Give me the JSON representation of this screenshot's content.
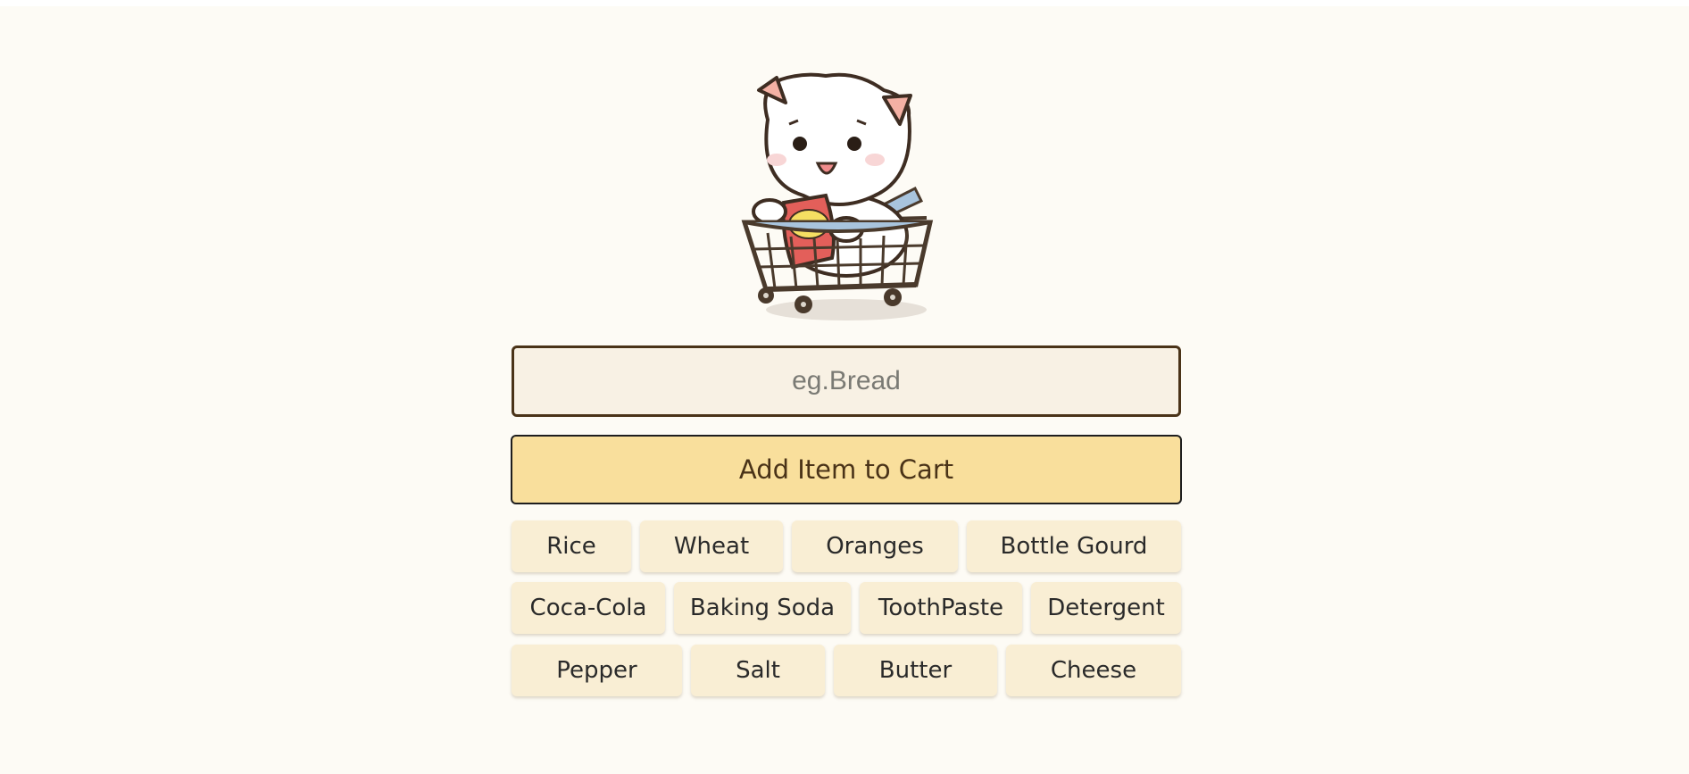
{
  "mascot": {
    "icon": "cat-in-shopping-cart-icon"
  },
  "search": {
    "placeholder": "eg.Bread",
    "value": ""
  },
  "add_button": {
    "label": "Add Item to Cart"
  },
  "items": [
    "Rice",
    "Wheat",
    "Oranges",
    "Bottle Gourd",
    "Coca-Cola",
    "Baking Soda",
    "ToothPaste",
    "Detergent",
    "Pepper",
    "Salt",
    "Butter",
    "Cheese"
  ],
  "colors": {
    "background": "#fdfbf5",
    "input_background": "#f8f1e4",
    "input_border": "#4a3318",
    "button_background": "#f9df9c",
    "chip_background": "#f9eed4"
  }
}
